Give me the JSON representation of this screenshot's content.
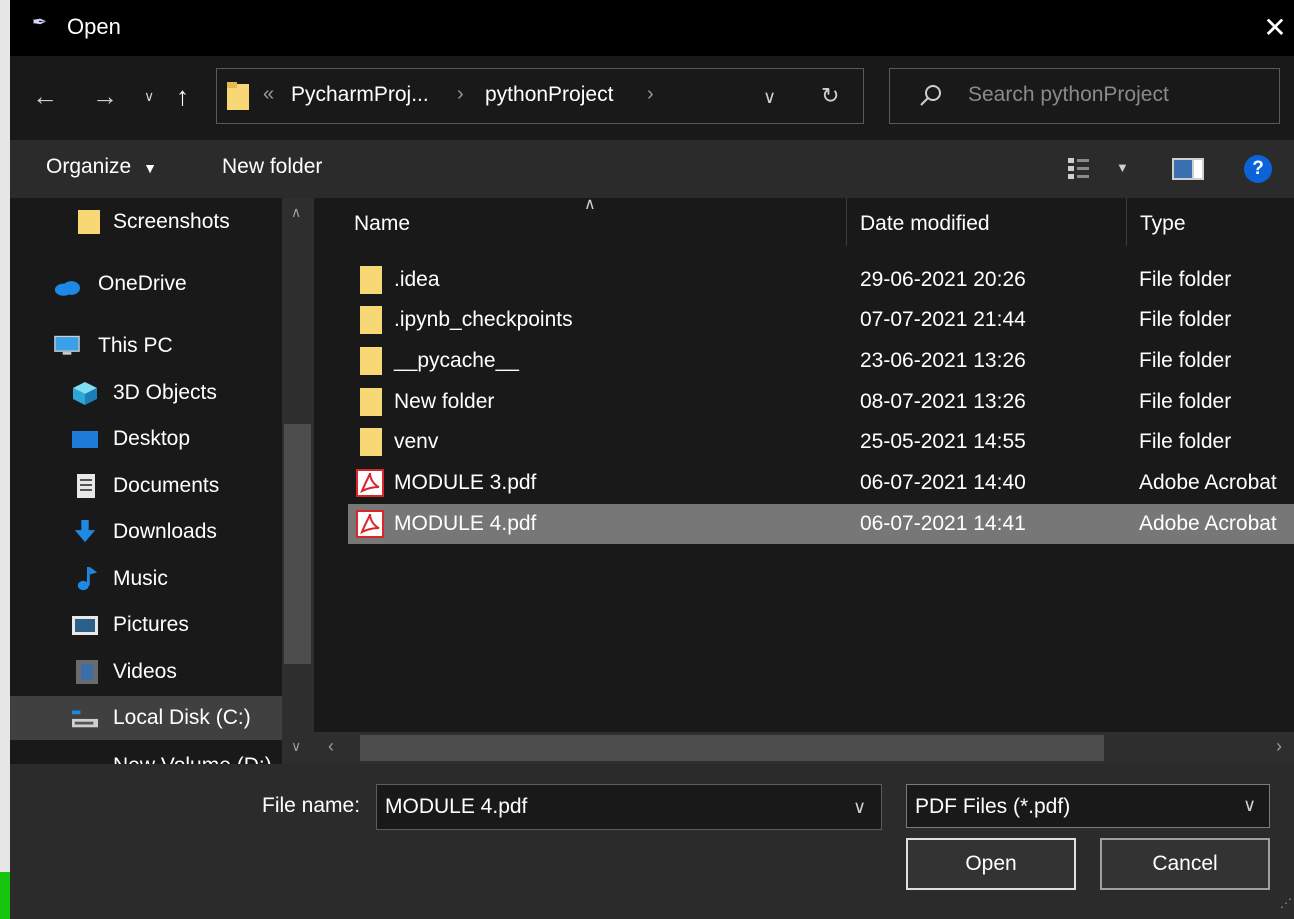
{
  "window": {
    "title": "Open"
  },
  "address": {
    "overflow": "«",
    "crumbs": [
      "PycharmProj...",
      "pythonProject"
    ]
  },
  "search": {
    "placeholder": "Search pythonProject"
  },
  "toolbar": {
    "organize": "Organize",
    "new_folder": "New folder",
    "help": "?"
  },
  "nav": {
    "items": [
      {
        "label": "Screenshots",
        "icon": "folder-icon"
      },
      {
        "label": "OneDrive",
        "icon": "cloud-icon"
      },
      {
        "label": "This PC",
        "icon": "computer-icon"
      },
      {
        "label": "3D Objects",
        "icon": "cube-icon"
      },
      {
        "label": "Desktop",
        "icon": "desktop-icon"
      },
      {
        "label": "Documents",
        "icon": "document-icon"
      },
      {
        "label": "Downloads",
        "icon": "download-icon"
      },
      {
        "label": "Music",
        "icon": "music-icon"
      },
      {
        "label": "Pictures",
        "icon": "pictures-icon"
      },
      {
        "label": "Videos",
        "icon": "videos-icon"
      },
      {
        "label": "Local Disk (C:)",
        "icon": "drive-icon"
      },
      {
        "label": "New Volume (D:)",
        "icon": "drive-icon"
      }
    ]
  },
  "files": {
    "columns": [
      "Name",
      "Date modified",
      "Type"
    ],
    "rows": [
      {
        "name": ".idea",
        "date": "29-06-2021 20:26",
        "type": "File folder",
        "icon": "folder-icon"
      },
      {
        "name": ".ipynb_checkpoints",
        "date": "07-07-2021 21:44",
        "type": "File folder",
        "icon": "folder-icon"
      },
      {
        "name": "__pycache__",
        "date": "23-06-2021 13:26",
        "type": "File folder",
        "icon": "folder-icon"
      },
      {
        "name": "New folder",
        "date": "08-07-2021 13:26",
        "type": "File folder",
        "icon": "folder-icon"
      },
      {
        "name": "venv",
        "date": "25-05-2021 14:55",
        "type": "File folder",
        "icon": "folder-icon"
      },
      {
        "name": "MODULE 3.pdf",
        "date": "06-07-2021 14:40",
        "type": "Adobe Acrobat",
        "icon": "pdf-icon"
      },
      {
        "name": "MODULE 4.pdf",
        "date": "06-07-2021 14:41",
        "type": "Adobe Acrobat",
        "icon": "pdf-icon",
        "selected": true
      }
    ]
  },
  "bottom": {
    "file_name_label": "File name:",
    "file_name_value": "MODULE 4.pdf",
    "filter": "PDF Files (*.pdf)",
    "open_label": "Open",
    "cancel_label": "Cancel"
  },
  "colors": {
    "selection": "#777777",
    "folder": "#f8d775",
    "pdf": "#d9262a",
    "accent": "#0a64d8"
  }
}
